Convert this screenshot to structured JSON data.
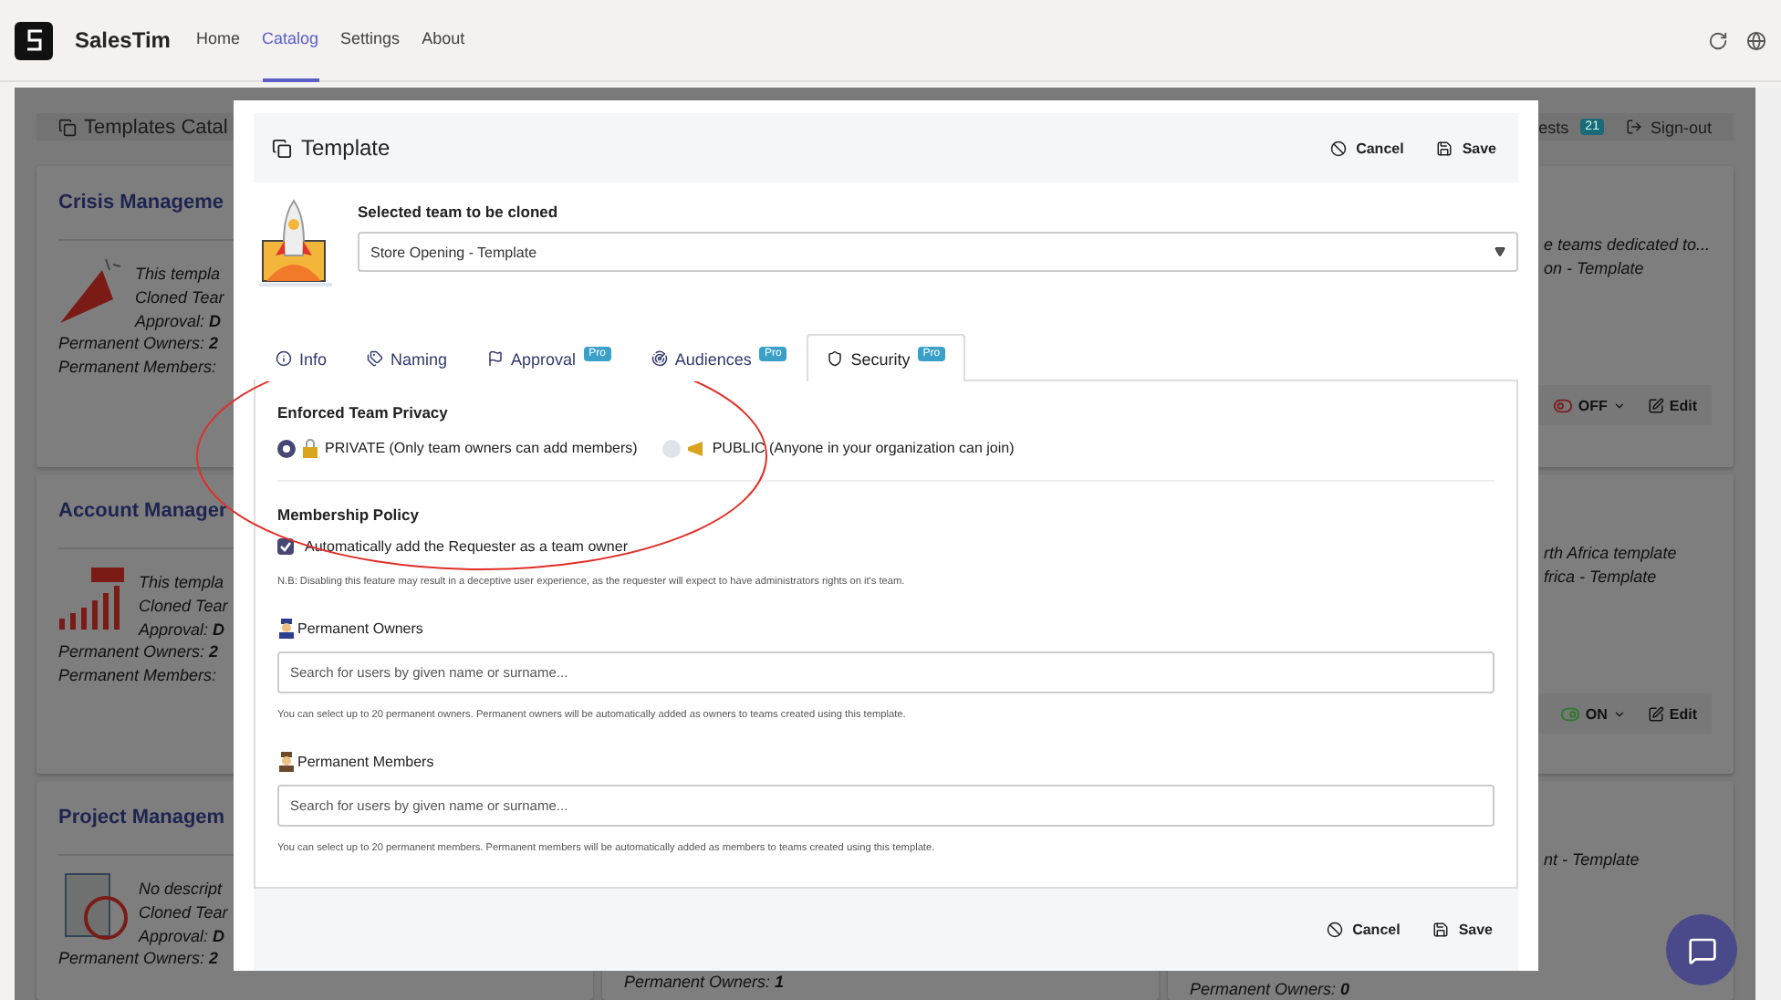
{
  "nav": {
    "brand": "SalesTim",
    "links": [
      {
        "label": "Home",
        "selected": false
      },
      {
        "label": "Catalog",
        "selected": true
      },
      {
        "label": "Settings",
        "selected": false
      },
      {
        "label": "About",
        "selected": false
      }
    ]
  },
  "catalog": {
    "title": "Templates Catal",
    "requests": "ests",
    "badge": "21",
    "signout": "Sign-out",
    "left_cards": [
      {
        "title": "Crisis Manageme",
        "kind": "megaphone",
        "lines": [
          "This templa",
          "Cloned Tear",
          "Approval: **D**"
        ],
        "stats": [
          "Permanent Owners: **2**",
          "Permanent Members:"
        ]
      },
      {
        "title": "Account Manager",
        "kind": "chart",
        "lines": [
          "This templa",
          "Cloned Tear",
          "Approval: **D**"
        ],
        "stats": [
          "Permanent Owners: **2**",
          "Permanent Members:"
        ]
      },
      {
        "title": "Project Managem",
        "kind": "clock",
        "lines": [
          "No descript",
          "Cloned Tear",
          "Approval: **D**"
        ],
        "stats": [
          "Permanent Owners: **2**"
        ]
      }
    ],
    "middle_stats": [
      "Permanent Owners: **1**"
    ],
    "right_cards": [
      {
        "lines": [
          "e teams dedicated to...",
          "on - Template"
        ],
        "toggle": {
          "label": "OFF",
          "on": false
        },
        "edit": "Edit"
      },
      {
        "lines": [
          "rth Africa template",
          "frica - Template"
        ],
        "toggle": {
          "label": "ON",
          "on": true
        },
        "edit": "Edit"
      },
      {
        "lines": [
          "nt - Template"
        ],
        "stats": [
          "Permanent Owners: **0**"
        ]
      }
    ]
  },
  "modal": {
    "title": "Template",
    "actions": [
      {
        "kind": "cancel",
        "label": "Cancel"
      },
      {
        "kind": "save",
        "label": "Save"
      }
    ],
    "team_label": "Selected team to be cloned",
    "team_value": "Store Opening - Template",
    "tabs": [
      {
        "kind": "info",
        "label": "Info",
        "selected": false
      },
      {
        "kind": "naming",
        "label": "Naming",
        "selected": false
      },
      {
        "kind": "approval",
        "label": "Approval",
        "badge": "Pro",
        "selected": false
      },
      {
        "kind": "audiences",
        "label": "Audiences",
        "badge": "Pro",
        "selected": false
      },
      {
        "kind": "security",
        "label": "Security",
        "badge": "Pro",
        "selected": true
      }
    ],
    "privacy": {
      "title": "Enforced Team Privacy",
      "options": [
        {
          "kind": "lock",
          "label": "PRIVATE (Only team owners can add members)",
          "selected": true
        },
        {
          "kind": "megaphone",
          "label": "PUBLIC (Anyone in your organization can join)",
          "selected": false
        }
      ]
    },
    "membership": {
      "title": "Membership Policy",
      "checkbox": {
        "label": "Automatically add the Requester as a team owner",
        "checked": true
      },
      "note": "N.B: Disabling this feature may result in a deceptive user experience, as the requester will expect to have administrators rights on it's team."
    },
    "people": [
      {
        "kind": "owners",
        "label": "Permanent Owners",
        "placeholder": "Search for users by given name or surname...",
        "help": "You can select up to 20 permanent owners. Permanent owners will be automatically added as owners to teams created using this template."
      },
      {
        "kind": "members",
        "label": "Permanent Members",
        "placeholder": "Search for users by given name or surname...",
        "help": "You can select up to 20 permanent members. Permanent members will be automatically added as members to teams created using this template."
      }
    ],
    "footer_actions": [
      {
        "kind": "cancel",
        "label": "Cancel"
      },
      {
        "kind": "save",
        "label": "Save"
      }
    ]
  }
}
